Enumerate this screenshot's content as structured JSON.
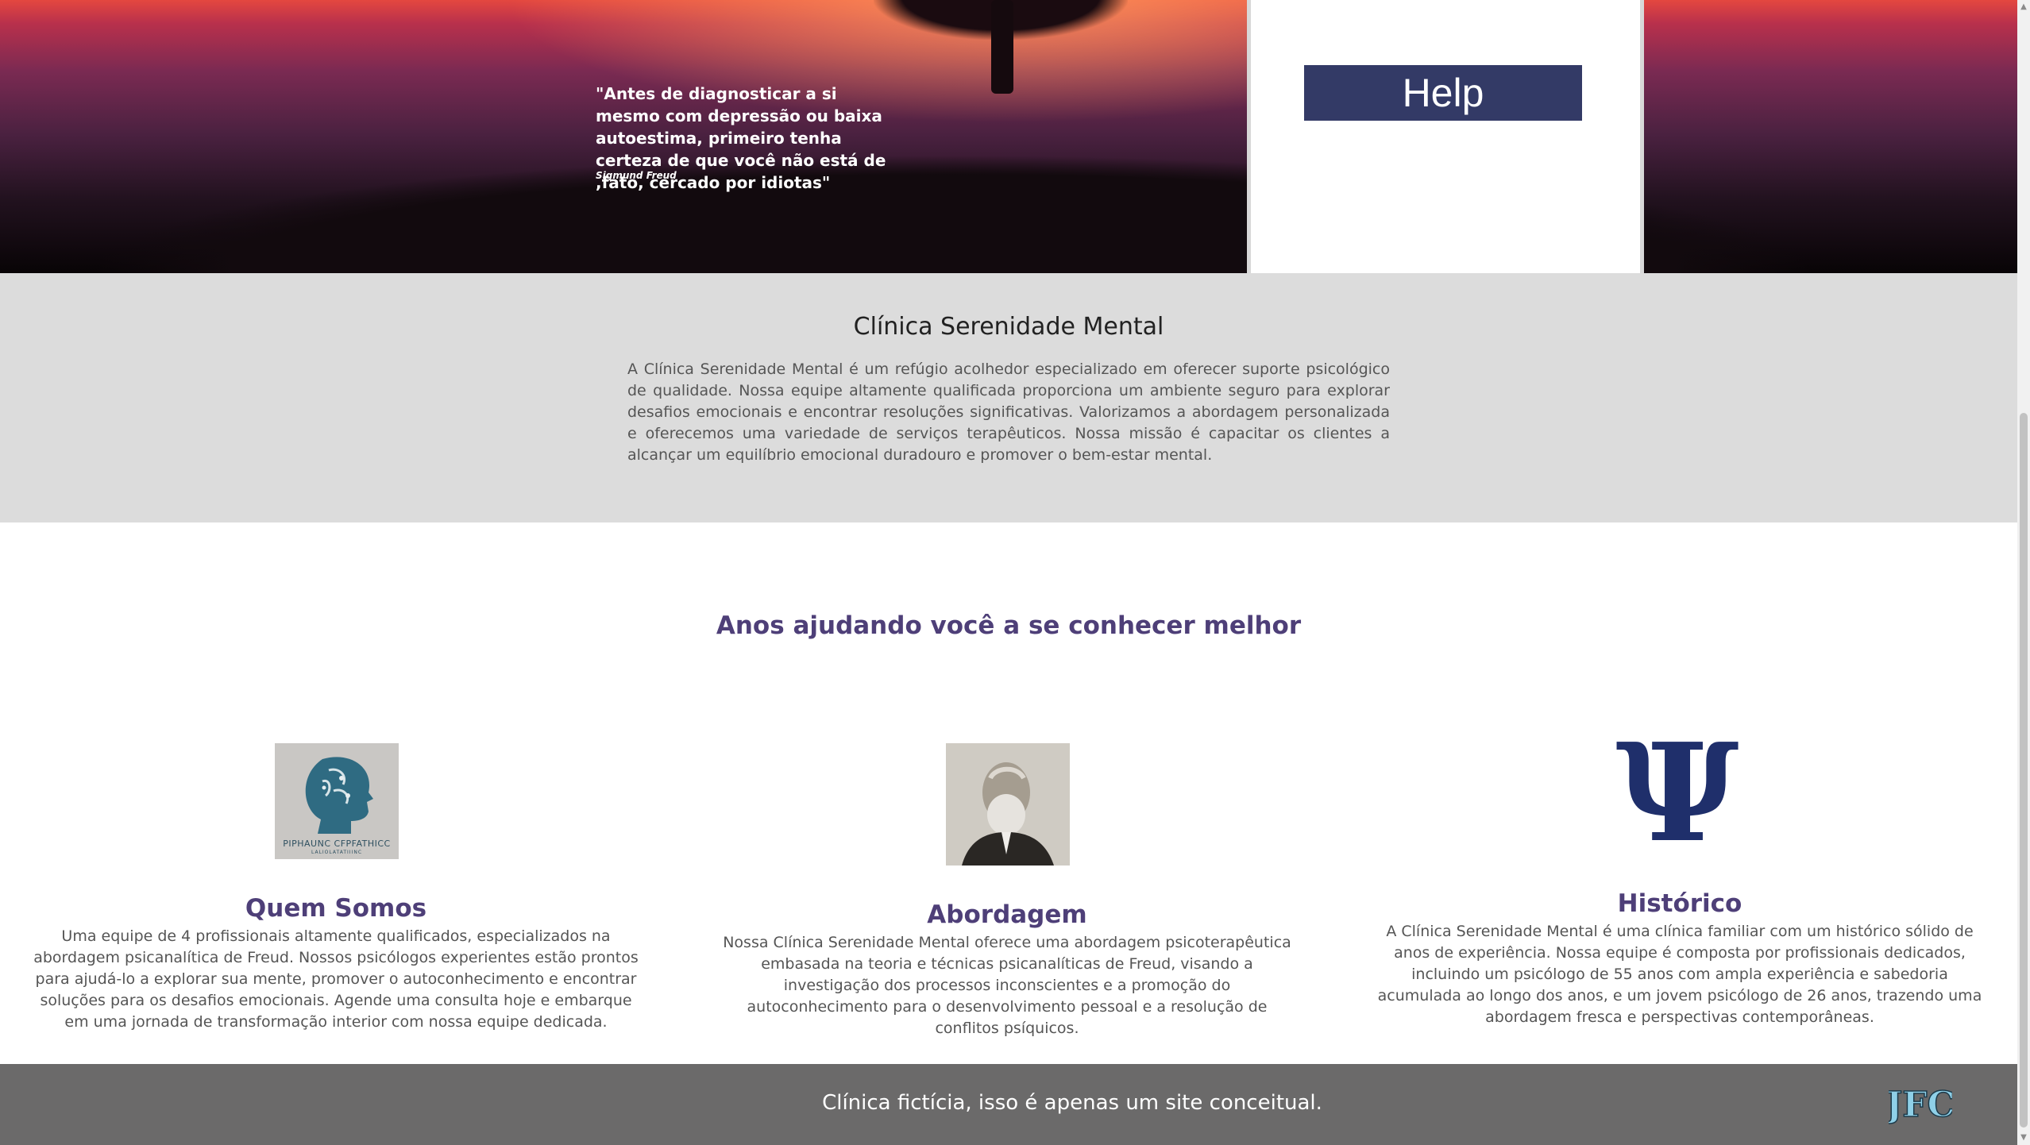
{
  "hero": {
    "quote": "\"Antes de diagnosticar a si mesmo com depressão ou baixa autoestima, primeiro tenha certeza de que você não está de ,fato, cercado por idiotas\"",
    "author": "Sigmund Freud",
    "help_label": "Help"
  },
  "about": {
    "title": "Clínica Serenidade Mental",
    "text": "A Clínica Serenidade Mental é um refúgio acolhedor especializado em oferecer suporte psicológico de qualidade. Nossa equipe altamente qualificada proporciona um ambiente seguro para explorar desafios emocionais e encontrar resoluções significativas. Valorizamos a abordagem personalizada e oferecemos uma variedade de serviços terapêuticos. Nossa missão é capacitar os clientes a alcançar um equilíbrio emocional duradouro e promover o bem-estar mental."
  },
  "tagline": "Anos ajudando você a se conhecer melhor",
  "columns": [
    {
      "title": "Quem Somos",
      "text": "Uma equipe de 4 profissionais altamente qualificados, especializados na abordagem psicanalítica de Freud. Nossos psicólogos experientes estão prontos para ajudá-lo a explorar sua mente, promover o autoconhecimento e encontrar soluções para os desafios emocionais. Agende uma consulta hoje e embarque em uma jornada de transformação interior com nossa equipe dedicada.",
      "image_text": "PIPHAUNC CFPFATHICC",
      "image_subtext": "LALIOLATATIIINC"
    },
    {
      "title": "Abordagem",
      "text": "Nossa Clínica Serenidade Mental oferece uma abordagem psicoterapêutica embasada na teoria e técnicas psicanalíticas de Freud, visando a investigação dos processos inconscientes e a promoção do autoconhecimento para o desenvolvimento pessoal e a resolução de conflitos psíquicos."
    },
    {
      "title": "Histórico",
      "text": "A Clínica Serenidade Mental é uma clínica familiar com um histórico sólido de anos de experiência. Nossa equipe é composta por profissionais dedicados, incluindo um psicólogo de 55 anos com ampla experiência e sabedoria acumulada ao longo dos anos, e um jovem psicólogo de 26 anos, trazendo uma abordagem fresca e perspectivas contemporâneas.",
      "symbol": "Ψ"
    }
  ],
  "footer": {
    "text": "Clínica fictícia, isso é apenas um site conceitual.",
    "logo_text": "JFC"
  },
  "colors": {
    "accent": "#333a66",
    "heading": "#4e3f78",
    "psi": "#1f2f6b",
    "footer_bg": "#6b6a6a",
    "about_bg": "#dcdcdc"
  }
}
